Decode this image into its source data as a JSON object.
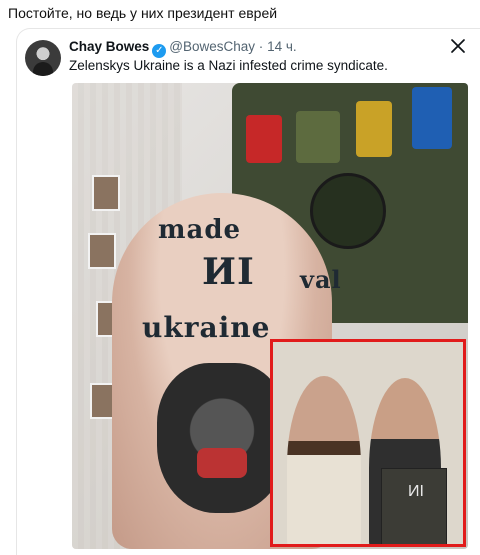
{
  "caption": "Постойте, но ведь у них президент еврей",
  "tweet": {
    "author": "Chay Bowes",
    "verified_icon": "✓",
    "handle": "@BowesChay",
    "separator": "·",
    "time": "14 ч.",
    "text": "Zelenskys Ukraine is a Nazi infested crime syndicate."
  },
  "media": {
    "tattoo_top": "made",
    "tattoo_middle": "ИI",
    "tattoo_bottom": "ukraine",
    "tattoo_side": "val",
    "book_mark": "ИI"
  },
  "icons": {
    "avatar": "avatar-icon",
    "verified": "verified-badge-icon",
    "x": "x-logo-icon"
  },
  "colors": {
    "accent": "#1d9bf0",
    "inset_border": "#e11b1b"
  }
}
